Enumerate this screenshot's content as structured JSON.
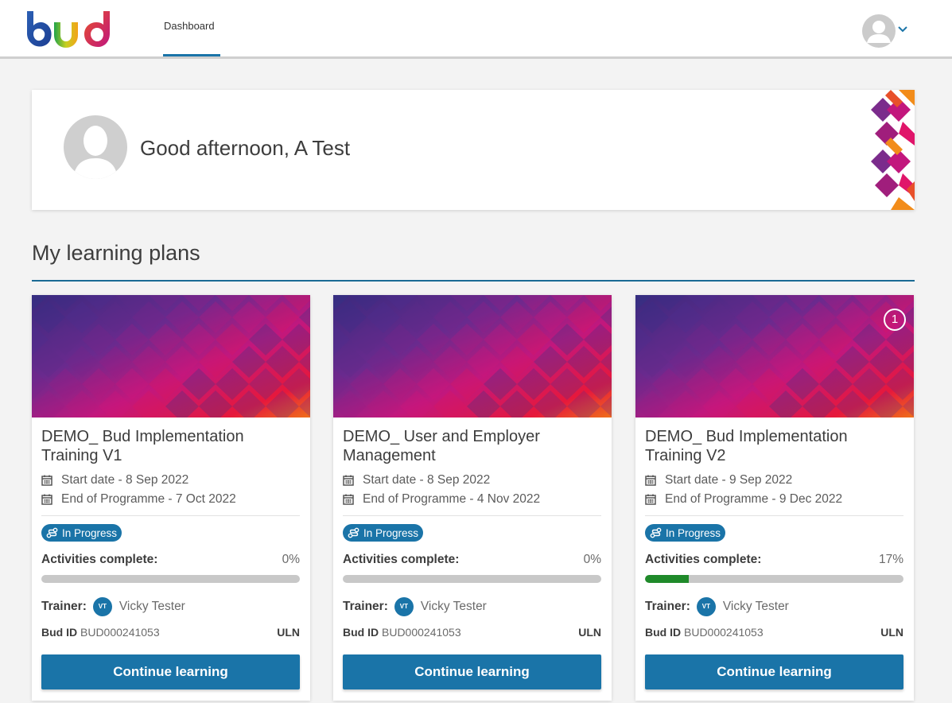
{
  "nav": {
    "tab_dashboard": "Dashboard",
    "logo_alt": "bud"
  },
  "greeting": {
    "text": "Good afternoon, A Test"
  },
  "section": {
    "title": "My learning plans"
  },
  "colors": {
    "primary": "#1a74a8",
    "progress_green": "#1f8a2a",
    "track_grey": "#c8c8c8"
  },
  "plans": [
    {
      "title": "DEMO_ Bud Implementation Training V1",
      "start": "Start date - 8 Sep 2022",
      "end": "End of Programme - 7 Oct 2022",
      "status": "In Progress",
      "activities_label": "Activities complete:",
      "activities_pct": "0%",
      "progress": 0,
      "trainer_label": "Trainer:",
      "trainer_initials": "VT",
      "trainer_name": "Vicky Tester",
      "budid_label": "Bud ID",
      "budid_value": "BUD000241053",
      "uln_label": "ULN",
      "button": "Continue learning",
      "badge": ""
    },
    {
      "title": "DEMO_ User and Employer Management",
      "start": "Start date - 8 Sep 2022",
      "end": "End of Programme - 4 Nov 2022",
      "status": "In Progress",
      "activities_label": "Activities complete:",
      "activities_pct": "0%",
      "progress": 0,
      "trainer_label": "Trainer:",
      "trainer_initials": "VT",
      "trainer_name": "Vicky Tester",
      "budid_label": "Bud ID",
      "budid_value": "BUD000241053",
      "uln_label": "ULN",
      "button": "Continue learning",
      "badge": ""
    },
    {
      "title": "DEMO_ Bud Implementation Training V2",
      "start": "Start date - 9 Sep 2022",
      "end": "End of Programme - 9 Dec 2022",
      "status": "In Progress",
      "activities_label": "Activities complete:",
      "activities_pct": "17%",
      "progress": 0.17,
      "trainer_label": "Trainer:",
      "trainer_initials": "VT",
      "trainer_name": "Vicky Tester",
      "budid_label": "Bud ID",
      "budid_value": "BUD000241053",
      "uln_label": "ULN",
      "button": "Continue learning",
      "badge": "1"
    }
  ]
}
